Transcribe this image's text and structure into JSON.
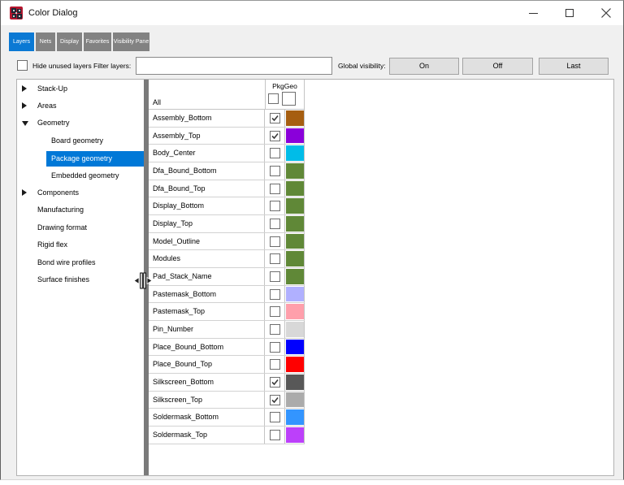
{
  "window": {
    "title": "Color Dialog",
    "controls": {
      "minimize": "minimize",
      "maximize": "maximize",
      "close": "close"
    }
  },
  "tabs": [
    {
      "label": "Layers",
      "selected": true
    },
    {
      "label": "Nets",
      "selected": false
    },
    {
      "label": "Display",
      "selected": false
    },
    {
      "label": "Favorites",
      "selected": false
    },
    {
      "label": "Visibility Pane",
      "selected": false
    }
  ],
  "toolbar": {
    "hide_unused_label": "Hide unused layers",
    "hide_unused_checked": false,
    "filter_label": "Filter layers:",
    "filter_value": "",
    "global_visibility_label": "Global visibility:",
    "buttons": [
      "On",
      "Off",
      "Last"
    ]
  },
  "tree": {
    "items": [
      {
        "label": "Stack-Up",
        "level": 0,
        "expander": "collapsed",
        "selected": false
      },
      {
        "label": "Areas",
        "level": 0,
        "expander": "collapsed",
        "selected": false
      },
      {
        "label": "Geometry",
        "level": 0,
        "expander": "expanded",
        "selected": false
      },
      {
        "label": "Board geometry",
        "level": 1,
        "expander": "none",
        "selected": false
      },
      {
        "label": "Package geometry",
        "level": 1,
        "expander": "none",
        "selected": true
      },
      {
        "label": "Embedded geometry",
        "level": 1,
        "expander": "none",
        "selected": false
      },
      {
        "label": "Components",
        "level": 0,
        "expander": "collapsed",
        "selected": false
      },
      {
        "label": "Manufacturing",
        "level": 0,
        "expander": "none",
        "selected": false
      },
      {
        "label": "Drawing format",
        "level": 0,
        "expander": "none",
        "selected": false
      },
      {
        "label": "Rigid flex",
        "level": 0,
        "expander": "none",
        "selected": false
      },
      {
        "label": "Bond wire profiles",
        "level": 0,
        "expander": "none",
        "selected": false
      },
      {
        "label": "Surface finishes",
        "level": 0,
        "expander": "none",
        "selected": false
      }
    ]
  },
  "table": {
    "group_header": "PkgGeo",
    "all_row": {
      "label": "All",
      "visibility_checked": false,
      "color_checked": false
    },
    "rows": [
      {
        "name": "Assembly_Bottom",
        "checked": true,
        "color": "#a65e10"
      },
      {
        "name": "Assembly_Top",
        "checked": true,
        "color": "#8a00da"
      },
      {
        "name": "Body_Center",
        "checked": false,
        "color": "#00bce8"
      },
      {
        "name": "Dfa_Bound_Bottom",
        "checked": false,
        "color": "#608837"
      },
      {
        "name": "Dfa_Bound_Top",
        "checked": false,
        "color": "#608837"
      },
      {
        "name": "Display_Bottom",
        "checked": false,
        "color": "#608837"
      },
      {
        "name": "Display_Top",
        "checked": false,
        "color": "#608837"
      },
      {
        "name": "Model_Outline",
        "checked": false,
        "color": "#608837"
      },
      {
        "name": "Modules",
        "checked": false,
        "color": "#608837"
      },
      {
        "name": "Pad_Stack_Name",
        "checked": false,
        "color": "#608837"
      },
      {
        "name": "Pastemask_Bottom",
        "checked": false,
        "color": "#b0b0ff"
      },
      {
        "name": "Pastemask_Top",
        "checked": false,
        "color": "#ff9fab"
      },
      {
        "name": "Pin_Number",
        "checked": false,
        "color": "#d8d8d8"
      },
      {
        "name": "Place_Bound_Bottom",
        "checked": false,
        "color": "#0000ff"
      },
      {
        "name": "Place_Bound_Top",
        "checked": false,
        "color": "#ff0000"
      },
      {
        "name": "Silkscreen_Bottom",
        "checked": true,
        "color": "#585858"
      },
      {
        "name": "Silkscreen_Top",
        "checked": true,
        "color": "#ababab"
      },
      {
        "name": "Soldermask_Bottom",
        "checked": false,
        "color": "#3395ff"
      },
      {
        "name": "Soldermask_Top",
        "checked": false,
        "color": "#bc40fa"
      }
    ]
  },
  "colors": {
    "accent": "#0078d7",
    "tab_unselected": "#828282",
    "dialog_bg": "#f0f0f0",
    "divider": "#7a7a7a"
  }
}
